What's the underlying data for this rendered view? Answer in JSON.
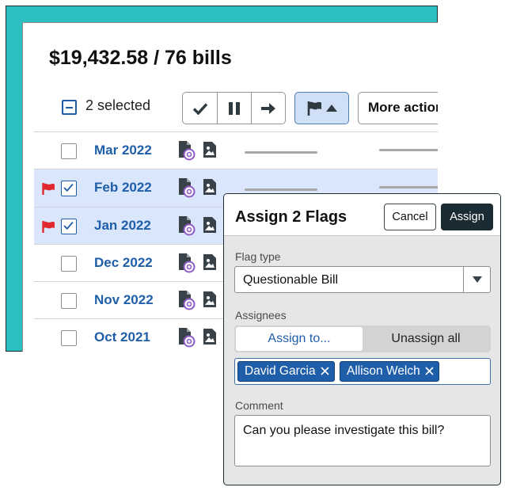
{
  "summary": {
    "total": "$19,432.58 / 76 bills"
  },
  "selection": {
    "count_label": "2 selected"
  },
  "toolbar": {
    "approve_icon": "checkmark-icon",
    "hold_icon": "pause-icon",
    "forward_icon": "arrow-right-icon",
    "flag_menu_icon": "flag-icon",
    "more_actions_label": "More actions"
  },
  "bills": [
    {
      "date": "Mar 2022",
      "selected": false,
      "flagged": false
    },
    {
      "date": "Feb 2022",
      "selected": true,
      "flagged": true
    },
    {
      "date": "Jan 2022",
      "selected": true,
      "flagged": true
    },
    {
      "date": "Dec 2022",
      "selected": false,
      "flagged": false
    },
    {
      "date": "Nov 2022",
      "selected": false,
      "flagged": false
    },
    {
      "date": "Oct 2021",
      "selected": false,
      "flagged": false
    }
  ],
  "modal": {
    "title": "Assign 2 Flags",
    "cancel_label": "Cancel",
    "assign_label": "Assign",
    "flag_type_label": "Flag type",
    "flag_type_value": "Questionable Bill",
    "assignees_label": "Assignees",
    "assign_to_label": "Assign to...",
    "unassign_all_label": "Unassign all",
    "assignees": [
      "David Garcia",
      "Allison Welch"
    ],
    "comment_label": "Comment",
    "comment_value": "Can you please investigate this bill?"
  },
  "colors": {
    "accent": "#1f5ea8",
    "teal_background": "#2bbfbf",
    "dark_button": "#1b2b33",
    "flag_red": "#e0282e",
    "selected_row": "#d9e6fb"
  }
}
